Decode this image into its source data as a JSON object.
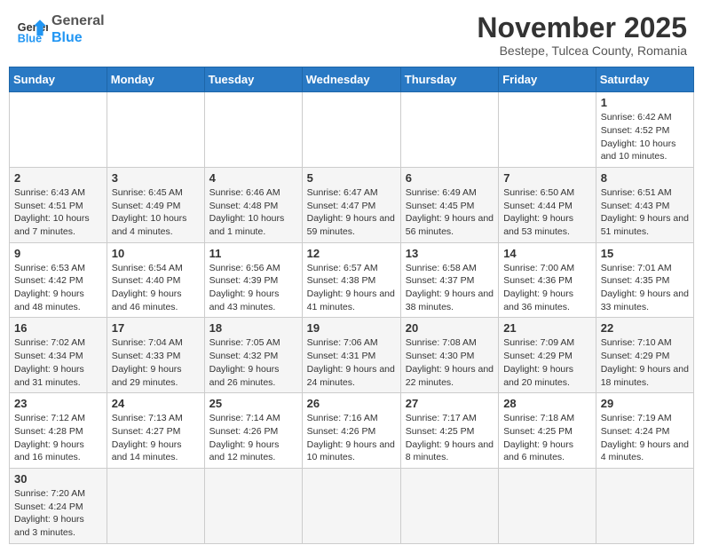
{
  "header": {
    "logo_general": "General",
    "logo_blue": "Blue",
    "month_title": "November 2025",
    "subtitle": "Bestepe, Tulcea County, Romania"
  },
  "weekdays": [
    "Sunday",
    "Monday",
    "Tuesday",
    "Wednesday",
    "Thursday",
    "Friday",
    "Saturday"
  ],
  "weeks": [
    [
      {
        "num": "",
        "info": ""
      },
      {
        "num": "",
        "info": ""
      },
      {
        "num": "",
        "info": ""
      },
      {
        "num": "",
        "info": ""
      },
      {
        "num": "",
        "info": ""
      },
      {
        "num": "",
        "info": ""
      },
      {
        "num": "1",
        "info": "Sunrise: 6:42 AM\nSunset: 4:52 PM\nDaylight: 10 hours and 10 minutes."
      }
    ],
    [
      {
        "num": "2",
        "info": "Sunrise: 6:43 AM\nSunset: 4:51 PM\nDaylight: 10 hours and 7 minutes."
      },
      {
        "num": "3",
        "info": "Sunrise: 6:45 AM\nSunset: 4:49 PM\nDaylight: 10 hours and 4 minutes."
      },
      {
        "num": "4",
        "info": "Sunrise: 6:46 AM\nSunset: 4:48 PM\nDaylight: 10 hours and 1 minute."
      },
      {
        "num": "5",
        "info": "Sunrise: 6:47 AM\nSunset: 4:47 PM\nDaylight: 9 hours and 59 minutes."
      },
      {
        "num": "6",
        "info": "Sunrise: 6:49 AM\nSunset: 4:45 PM\nDaylight: 9 hours and 56 minutes."
      },
      {
        "num": "7",
        "info": "Sunrise: 6:50 AM\nSunset: 4:44 PM\nDaylight: 9 hours and 53 minutes."
      },
      {
        "num": "8",
        "info": "Sunrise: 6:51 AM\nSunset: 4:43 PM\nDaylight: 9 hours and 51 minutes."
      }
    ],
    [
      {
        "num": "9",
        "info": "Sunrise: 6:53 AM\nSunset: 4:42 PM\nDaylight: 9 hours and 48 minutes."
      },
      {
        "num": "10",
        "info": "Sunrise: 6:54 AM\nSunset: 4:40 PM\nDaylight: 9 hours and 46 minutes."
      },
      {
        "num": "11",
        "info": "Sunrise: 6:56 AM\nSunset: 4:39 PM\nDaylight: 9 hours and 43 minutes."
      },
      {
        "num": "12",
        "info": "Sunrise: 6:57 AM\nSunset: 4:38 PM\nDaylight: 9 hours and 41 minutes."
      },
      {
        "num": "13",
        "info": "Sunrise: 6:58 AM\nSunset: 4:37 PM\nDaylight: 9 hours and 38 minutes."
      },
      {
        "num": "14",
        "info": "Sunrise: 7:00 AM\nSunset: 4:36 PM\nDaylight: 9 hours and 36 minutes."
      },
      {
        "num": "15",
        "info": "Sunrise: 7:01 AM\nSunset: 4:35 PM\nDaylight: 9 hours and 33 minutes."
      }
    ],
    [
      {
        "num": "16",
        "info": "Sunrise: 7:02 AM\nSunset: 4:34 PM\nDaylight: 9 hours and 31 minutes."
      },
      {
        "num": "17",
        "info": "Sunrise: 7:04 AM\nSunset: 4:33 PM\nDaylight: 9 hours and 29 minutes."
      },
      {
        "num": "18",
        "info": "Sunrise: 7:05 AM\nSunset: 4:32 PM\nDaylight: 9 hours and 26 minutes."
      },
      {
        "num": "19",
        "info": "Sunrise: 7:06 AM\nSunset: 4:31 PM\nDaylight: 9 hours and 24 minutes."
      },
      {
        "num": "20",
        "info": "Sunrise: 7:08 AM\nSunset: 4:30 PM\nDaylight: 9 hours and 22 minutes."
      },
      {
        "num": "21",
        "info": "Sunrise: 7:09 AM\nSunset: 4:29 PM\nDaylight: 9 hours and 20 minutes."
      },
      {
        "num": "22",
        "info": "Sunrise: 7:10 AM\nSunset: 4:29 PM\nDaylight: 9 hours and 18 minutes."
      }
    ],
    [
      {
        "num": "23",
        "info": "Sunrise: 7:12 AM\nSunset: 4:28 PM\nDaylight: 9 hours and 16 minutes."
      },
      {
        "num": "24",
        "info": "Sunrise: 7:13 AM\nSunset: 4:27 PM\nDaylight: 9 hours and 14 minutes."
      },
      {
        "num": "25",
        "info": "Sunrise: 7:14 AM\nSunset: 4:26 PM\nDaylight: 9 hours and 12 minutes."
      },
      {
        "num": "26",
        "info": "Sunrise: 7:16 AM\nSunset: 4:26 PM\nDaylight: 9 hours and 10 minutes."
      },
      {
        "num": "27",
        "info": "Sunrise: 7:17 AM\nSunset: 4:25 PM\nDaylight: 9 hours and 8 minutes."
      },
      {
        "num": "28",
        "info": "Sunrise: 7:18 AM\nSunset: 4:25 PM\nDaylight: 9 hours and 6 minutes."
      },
      {
        "num": "29",
        "info": "Sunrise: 7:19 AM\nSunset: 4:24 PM\nDaylight: 9 hours and 4 minutes."
      }
    ],
    [
      {
        "num": "30",
        "info": "Sunrise: 7:20 AM\nSunset: 4:24 PM\nDaylight: 9 hours and 3 minutes."
      },
      {
        "num": "",
        "info": ""
      },
      {
        "num": "",
        "info": ""
      },
      {
        "num": "",
        "info": ""
      },
      {
        "num": "",
        "info": ""
      },
      {
        "num": "",
        "info": ""
      },
      {
        "num": "",
        "info": ""
      }
    ]
  ]
}
